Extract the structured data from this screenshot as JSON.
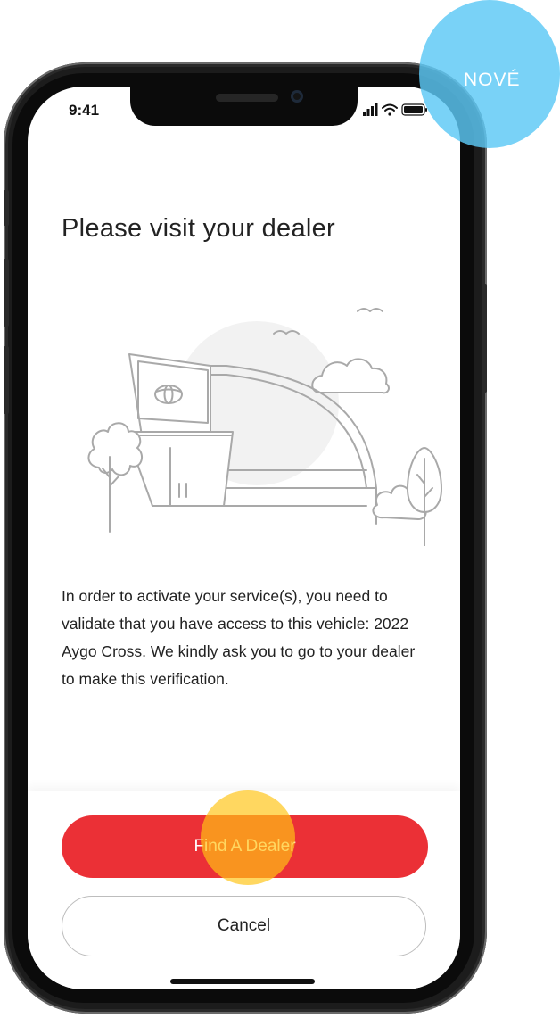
{
  "status_bar": {
    "time": "9:41"
  },
  "page": {
    "title": "Please visit your dealer",
    "description": "In order to activate your service(s), you need to validate that you have access to this vehicle: 2022 Aygo Cross. We kindly ask you to go to your dealer to make this verification."
  },
  "actions": {
    "primary_label": "Find A Dealer",
    "secondary_label": "Cancel"
  },
  "badge": {
    "label": "NOVÉ"
  },
  "colors": {
    "primary_button": "#eb3036",
    "badge": "#5cc8f5",
    "tap_indicator": "#ffc414",
    "illustration_stroke": "#a9a9a9"
  },
  "icons": [
    "signal-icon",
    "wifi-icon",
    "battery-icon",
    "dealership-illustration"
  ]
}
